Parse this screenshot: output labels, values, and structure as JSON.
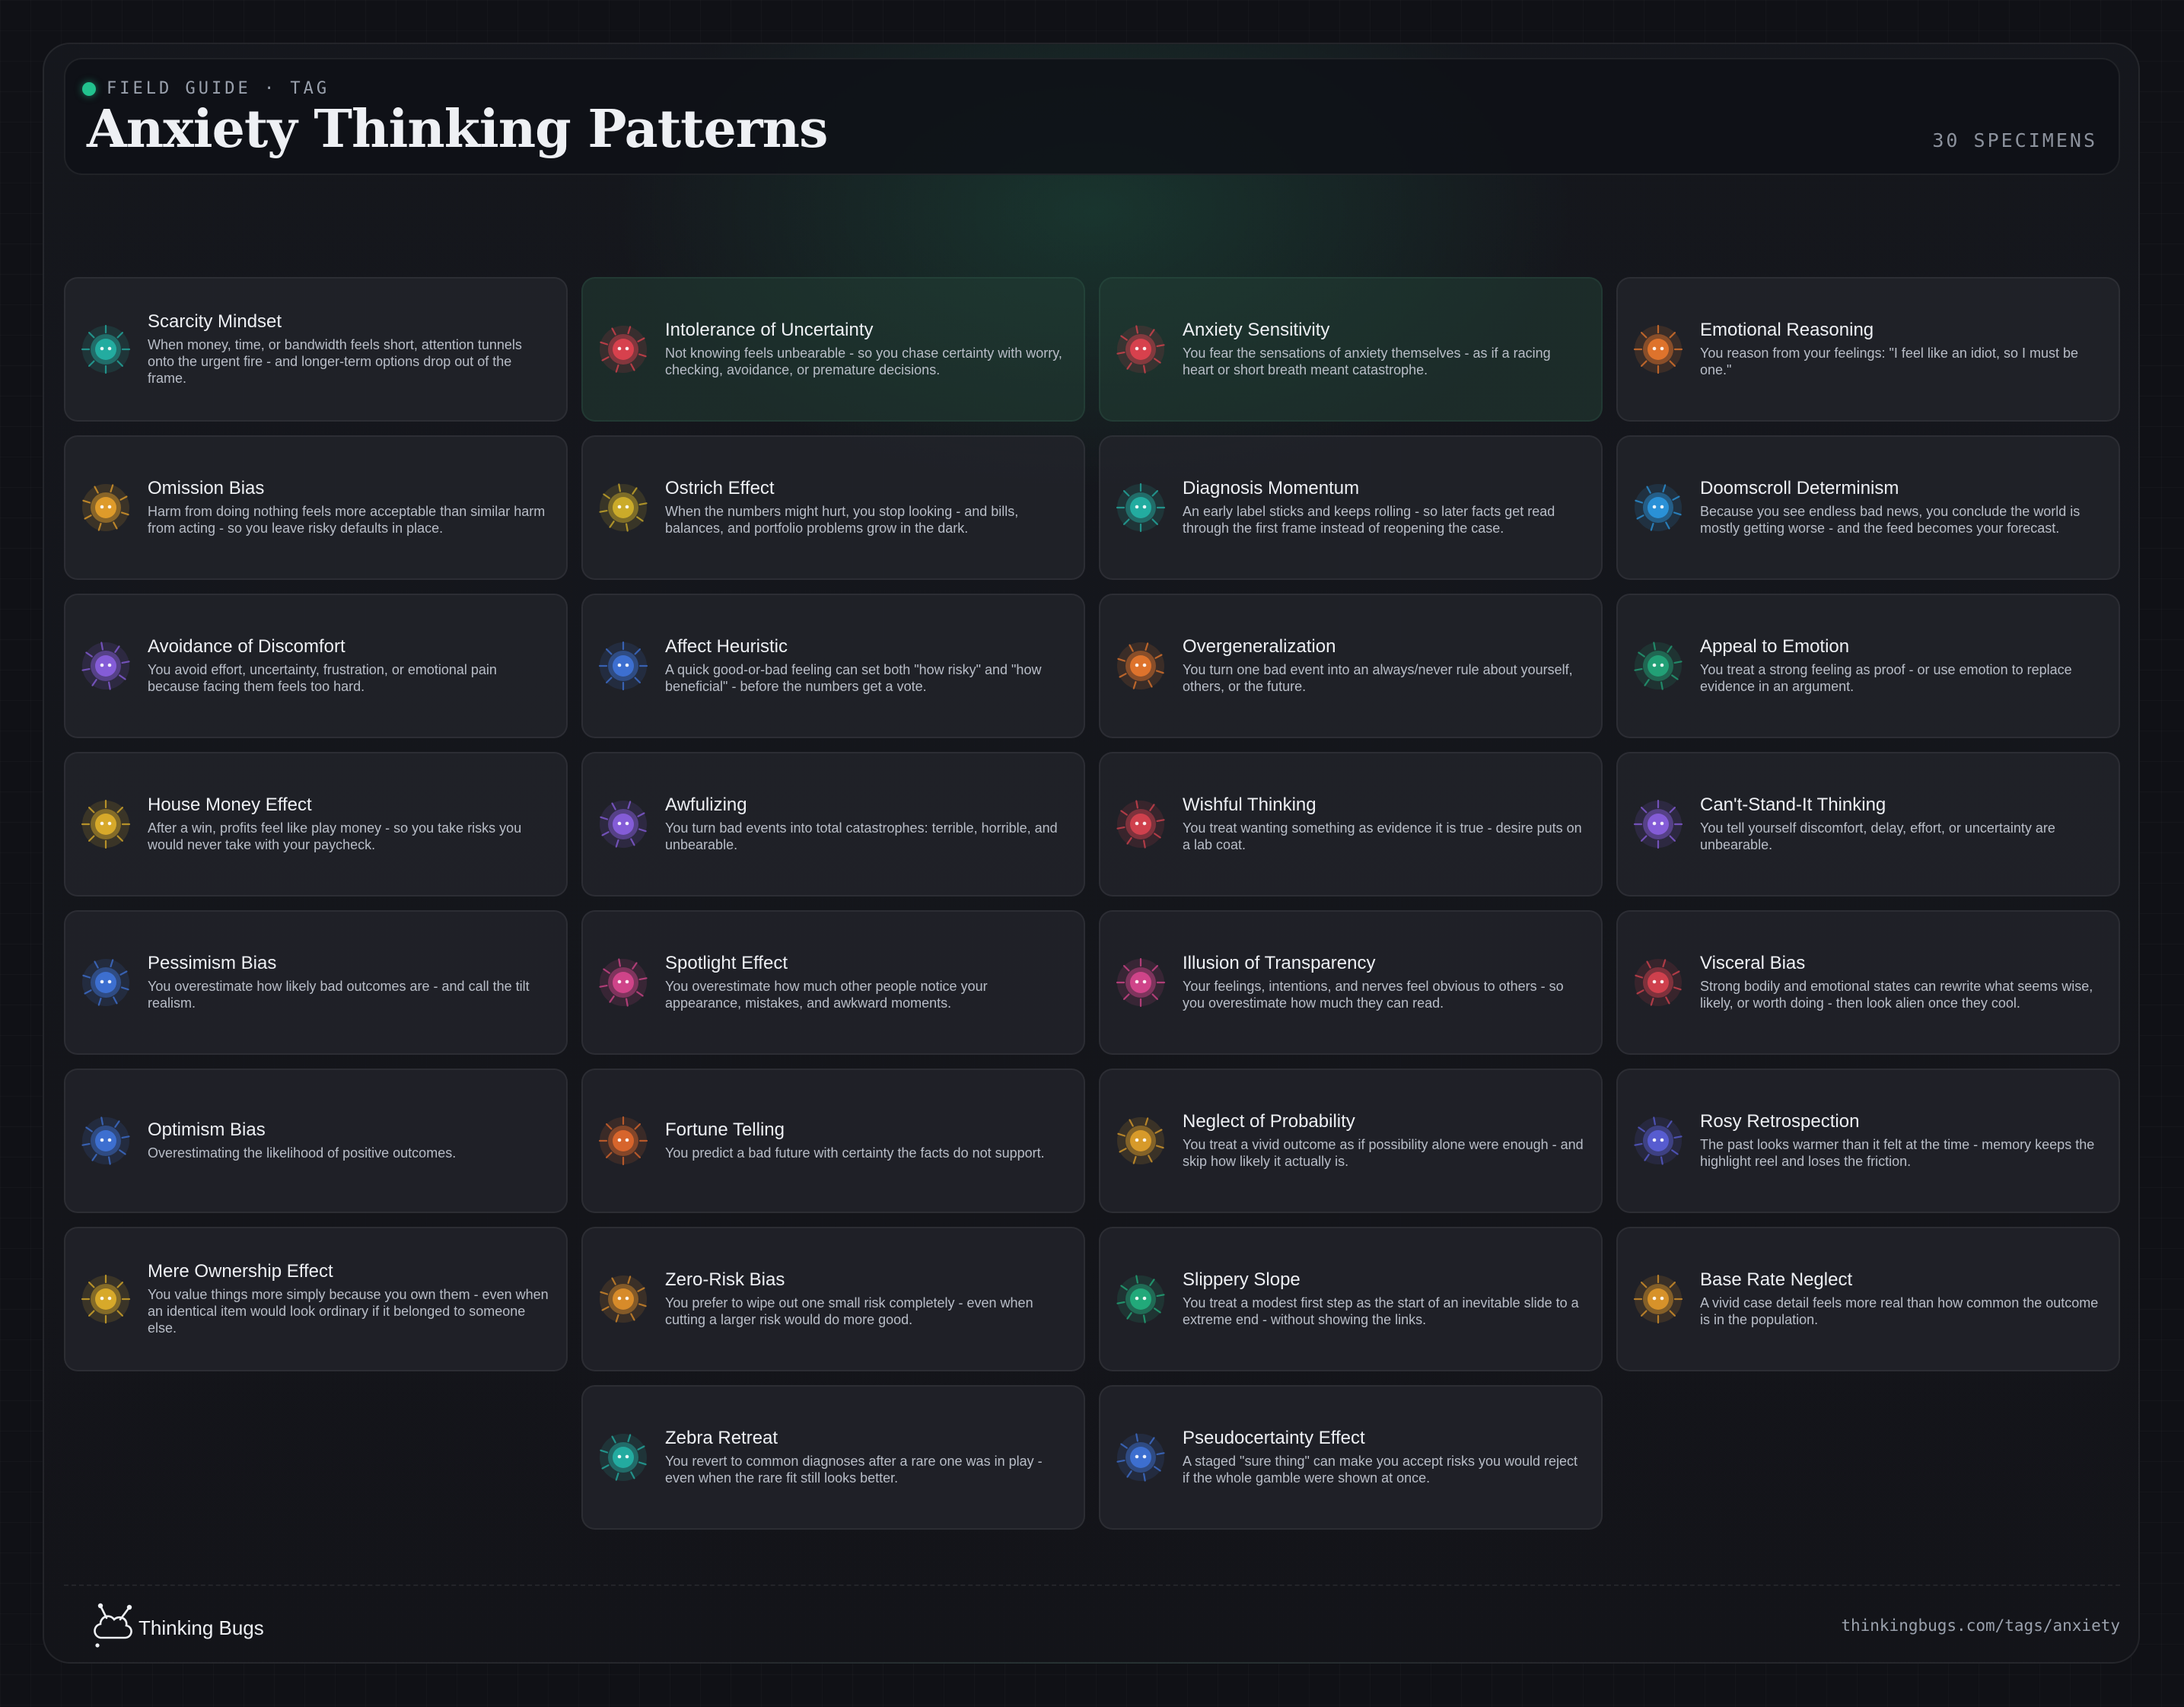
{
  "header": {
    "eyebrow": "FIELD GUIDE · TAG",
    "title": "Anxiety Thinking Patterns",
    "count": "30 SPECIMENS"
  },
  "cards": [
    {
      "title": "Scarcity Mindset",
      "desc": "When money, time, or bandwidth feels short, attention tunnels onto the urgent fire - and longer-term options drop out of the frame.",
      "color": "#23b2a6"
    },
    {
      "title": "Intolerance of Uncertainty",
      "desc": "Not knowing feels unbearable - so you chase certainty with worry, checking, avoidance, or premature decisions.",
      "color": "#e0434f"
    },
    {
      "title": "Anxiety Sensitivity",
      "desc": "You fear the sensations of anxiety themselves - as if a racing heart or short breath meant catastrophe.",
      "color": "#e0434f"
    },
    {
      "title": "Emotional Reasoning",
      "desc": "You reason from your feelings: \"I feel like an idiot, so I must be one.\"",
      "color": "#e8782c"
    },
    {
      "title": "Omission Bias",
      "desc": "Harm from doing nothing feels more acceptable than similar harm from acting - so you leave risky defaults in place.",
      "color": "#e8a12a"
    },
    {
      "title": "Ostrich Effect",
      "desc": "When the numbers might hurt, you stop looking - and bills, balances, and portfolio problems grow in the dark.",
      "color": "#d4b12a"
    },
    {
      "title": "Diagnosis Momentum",
      "desc": "An early label sticks and keeps rolling - so later facts get read through the first frame instead of reopening the case.",
      "color": "#23b2a6"
    },
    {
      "title": "Doomscroll Determinism",
      "desc": "Because you see endless bad news, you conclude the world is mostly getting worse - and the feed becomes your forecast.",
      "color": "#2b97e0"
    },
    {
      "title": "Avoidance of Discomfort",
      "desc": "You avoid effort, uncertainty, frustration, or emotional pain because facing them feels too hard.",
      "color": "#8a5fe0"
    },
    {
      "title": "Affect Heuristic",
      "desc": "A quick good-or-bad feeling can set both \"how risky\" and \"how beneficial\" - before the numbers get a vote.",
      "color": "#3f73d8"
    },
    {
      "title": "Overgeneralization",
      "desc": "You turn one bad event into an always/never rule about yourself, others, or the future.",
      "color": "#e8782c"
    },
    {
      "title": "Appeal to Emotion",
      "desc": "You treat a strong feeling as proof - or use emotion to replace evidence in an argument.",
      "color": "#22a67a"
    },
    {
      "title": "House Money Effect",
      "desc": "After a win, profits feel like play money - so you take risks you would never take with your paycheck.",
      "color": "#e0b02a"
    },
    {
      "title": "Awfulizing",
      "desc": "You turn bad events into total catastrophes: terrible, horrible, and unbearable.",
      "color": "#8a5fe0"
    },
    {
      "title": "Wishful Thinking",
      "desc": "You treat wanting something as evidence it is true - desire puts on a lab coat.",
      "color": "#d8434f"
    },
    {
      "title": "Can't-Stand-It Thinking",
      "desc": "You tell yourself discomfort, delay, effort, or uncertainty are unbearable.",
      "color": "#8a5fe0"
    },
    {
      "title": "Pessimism Bias",
      "desc": "You overestimate how likely bad outcomes are - and call the tilt realism.",
      "color": "#3f73d8"
    },
    {
      "title": "Spotlight Effect",
      "desc": "You overestimate how much other people notice your appearance, mistakes, and awkward moments.",
      "color": "#d8468e"
    },
    {
      "title": "Illusion of Transparency",
      "desc": "Your feelings, intentions, and nerves feel obvious to others - so you overestimate how much they can read.",
      "color": "#d8468e"
    },
    {
      "title": "Visceral Bias",
      "desc": "Strong bodily and emotional states can rewrite what seems wise, likely, or worth doing - then look alien once they cool.",
      "color": "#d8434f"
    },
    {
      "title": "Optimism Bias",
      "desc": "Overestimating the likelihood of positive outcomes.",
      "color": "#3f73d8"
    },
    {
      "title": "Fortune Telling",
      "desc": "You predict a bad future with certainty the facts do not support.",
      "color": "#e0682c"
    },
    {
      "title": "Neglect of Probability",
      "desc": "You treat a vivid outcome as if possibility alone were enough - and skip how likely it actually is.",
      "color": "#e0a02a"
    },
    {
      "title": "Rosy Retrospection",
      "desc": "The past looks warmer than it felt at the time - memory keeps the highlight reel and loses the friction.",
      "color": "#5a5fd8"
    },
    {
      "title": "Mere Ownership Effect",
      "desc": "You value things more simply because you own them - even when an identical item would look ordinary if it belonged to someone else.",
      "color": "#e0b02a"
    },
    {
      "title": "Zero-Risk Bias",
      "desc": "You prefer to wipe out one small risk completely - even when cutting a larger risk would do more good.",
      "color": "#e0902a"
    },
    {
      "title": "Slippery Slope",
      "desc": "You treat a modest first step as the start of an inevitable slide to a extreme end - without showing the links.",
      "color": "#22b07e"
    },
    {
      "title": "Base Rate Neglect",
      "desc": "A vivid case detail feels more real than how common the outcome is in the population.",
      "color": "#e0982a"
    },
    {
      "title": "Zebra Retreat",
      "desc": "You revert to common diagnoses after a rare one was in play - even when the rare fit still looks better.",
      "color": "#23b2a6"
    },
    {
      "title": "Pseudocertainty Effect",
      "desc": "A staged \"sure thing\" can make you accept risks you would reject if the whole gamble were shown at once.",
      "color": "#3f73d8"
    }
  ],
  "footer": {
    "brand": "Thinking Bugs",
    "url": "thinkingbugs.com/tags/anxiety"
  }
}
